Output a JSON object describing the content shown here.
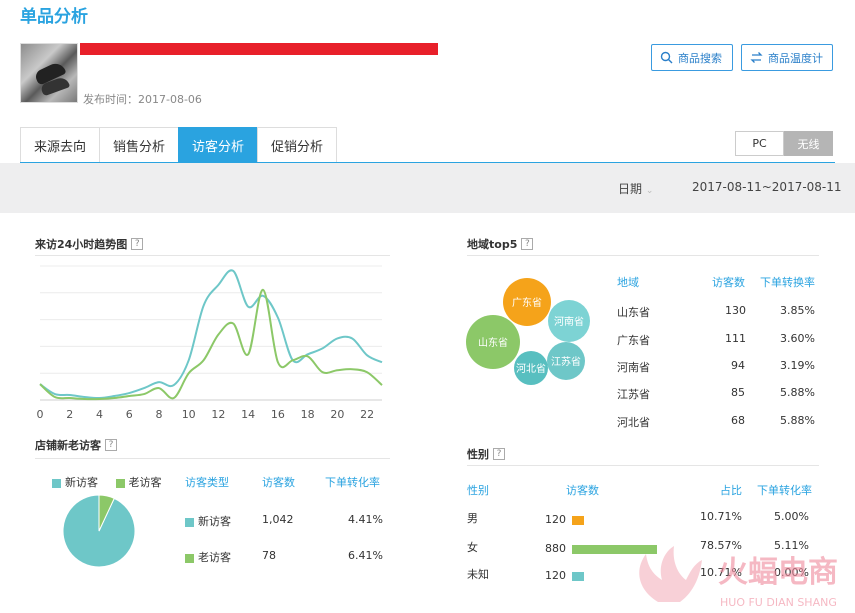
{
  "header": {
    "title": "单品分析",
    "publish_time": "发布时间：2017-08-06",
    "search_button": "商品搜索",
    "temp_button": "商品温度计"
  },
  "tabs": [
    {
      "label": "来源去向",
      "active": false
    },
    {
      "label": "销售分析",
      "active": false
    },
    {
      "label": "访客分析",
      "active": true
    },
    {
      "label": "促销分析",
      "active": false
    }
  ],
  "device_switch": {
    "pc": "PC",
    "wireless": "无线",
    "selected": "无线"
  },
  "date": {
    "label": "日期",
    "range": "2017-08-11~2017-08-11"
  },
  "trend": {
    "title": "来访24小时趋势图",
    "help": "?"
  },
  "chart_data": {
    "type": "line",
    "title": "来访24小时趋势图",
    "x": [
      0,
      1,
      2,
      3,
      4,
      5,
      6,
      7,
      8,
      9,
      10,
      11,
      12,
      13,
      14,
      15,
      16,
      17,
      18,
      19,
      20,
      21,
      22,
      23
    ],
    "xticks": [
      "0",
      "2",
      "4",
      "6",
      "8",
      "10",
      "12",
      "14",
      "16",
      "18",
      "20",
      "22"
    ],
    "ylim": [
      0,
      135
    ],
    "grid": true,
    "series": [
      {
        "color": "#6ec7c8",
        "values": [
          16,
          6,
          5,
          3,
          2,
          4,
          7,
          12,
          18,
          15,
          40,
          95,
          116,
          130,
          94,
          105,
          83,
          40,
          46,
          52,
          62,
          62,
          45,
          38
        ]
      },
      {
        "color": "#8cc868",
        "values": [
          16,
          3,
          2,
          1,
          1,
          2,
          4,
          6,
          12,
          2,
          27,
          40,
          66,
          77,
          46,
          111,
          38,
          40,
          44,
          28,
          30,
          31,
          28,
          15
        ]
      }
    ]
  },
  "region": {
    "title": "地域top5",
    "help": "?",
    "headers": [
      "地域",
      "访客数",
      "下单转换率"
    ],
    "rows": [
      {
        "name": "山东省",
        "visitors": "130",
        "rate": "3.85%"
      },
      {
        "name": "广东省",
        "visitors": "111",
        "rate": "3.60%"
      },
      {
        "name": "河南省",
        "visitors": "94",
        "rate": "3.19%"
      },
      {
        "name": "江苏省",
        "visitors": "85",
        "rate": "5.88%"
      },
      {
        "name": "河北省",
        "visitors": "68",
        "rate": "5.88%"
      }
    ],
    "bubbles": [
      {
        "label": "广东省",
        "color": "#f5a31a"
      },
      {
        "label": "河南省",
        "color": "#7dd3d4"
      },
      {
        "label": "山东省",
        "color": "#8cc868"
      },
      {
        "label": "江苏省",
        "color": "#6ec7c8"
      },
      {
        "label": "河北省",
        "color": "#58bfc0"
      }
    ]
  },
  "new_old": {
    "title": "店铺新老访客",
    "help": "?",
    "legend_new": "新访客",
    "legend_old": "老访客",
    "headers": [
      "访客类型",
      "访客数",
      "下单转化率"
    ],
    "rows": [
      {
        "type": "新访客",
        "visitors": "1,042",
        "rate": "4.41%",
        "color": "#6ec7c8"
      },
      {
        "type": "老访客",
        "visitors": "78",
        "rate": "6.41%",
        "color": "#8cc868"
      }
    ],
    "pie": {
      "new_share": 0.9304,
      "old_share": 0.0696
    }
  },
  "gender": {
    "title": "性别",
    "help": "?",
    "headers": [
      "性别",
      "访客数",
      "占比",
      "下单转化率"
    ],
    "rows": [
      {
        "gender": "男",
        "visitors": "120",
        "share": "10.71%",
        "rate": "5.00%",
        "color": "#f5a31a",
        "fraction": 0.1071
      },
      {
        "gender": "女",
        "visitors": "880",
        "share": "78.57%",
        "rate": "5.11%",
        "color": "#8cc868",
        "fraction": 0.7857
      },
      {
        "gender": "未知",
        "visitors": "120",
        "share": "10.71%",
        "rate": "0.00%",
        "color": "#6ec7c8",
        "fraction": 0.1071
      }
    ]
  },
  "watermark": {
    "text": "火蝠电商",
    "sub": "HUO FU DIAN SHANG"
  }
}
